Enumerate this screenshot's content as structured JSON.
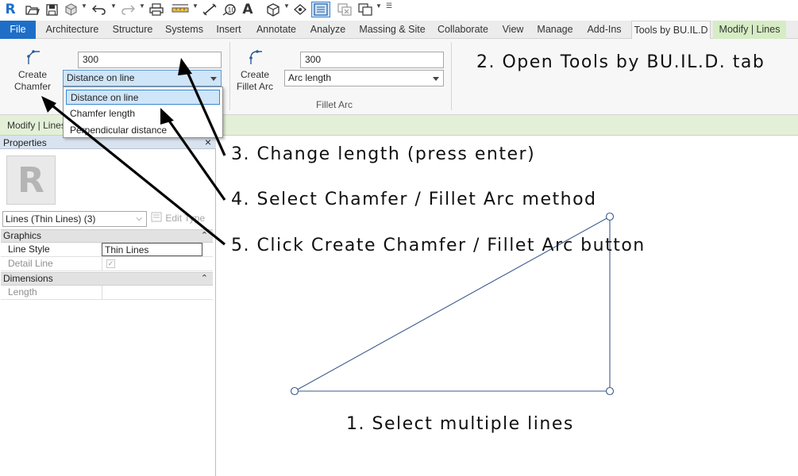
{
  "app": {
    "logo_letter": "R"
  },
  "qat": {
    "icons": [
      "revit-logo-icon",
      "open-icon",
      "save-icon",
      "sync-icon",
      "undo-icon",
      "redo-icon",
      "print-icon",
      "measure-icon",
      "align-dimension-icon",
      "tag-icon",
      "text-icon",
      "3d-view-icon",
      "section-icon",
      "thin-lines-icon",
      "close-hidden-icon",
      "switch-windows-icon",
      "customize-icon"
    ],
    "text_glyph": "A"
  },
  "tabs": [
    {
      "label": "File"
    },
    {
      "label": "Architecture"
    },
    {
      "label": "Structure"
    },
    {
      "label": "Systems"
    },
    {
      "label": "Insert"
    },
    {
      "label": "Annotate"
    },
    {
      "label": "Analyze"
    },
    {
      "label": "Massing & Site"
    },
    {
      "label": "Collaborate"
    },
    {
      "label": "View"
    },
    {
      "label": "Manage"
    },
    {
      "label": "Add-Ins"
    },
    {
      "label": "Tools by BU.IL.D"
    },
    {
      "label": "Modify | Lines"
    }
  ],
  "ribbon": {
    "chamfer": {
      "button_line1": "Create",
      "button_line2": "Chamfer",
      "length_value": "300",
      "method_selected": "Distance on line",
      "method_options": [
        "Distance on line",
        "Chamfer length",
        "Perpendicular distance"
      ]
    },
    "fillet": {
      "button_line1": "Create",
      "button_line2": "Fillet Arc",
      "length_value": "300",
      "method_selected": "Arc length",
      "panel_label": "Fillet Arc"
    }
  },
  "modify_bar": {
    "label": "Modify | Lines"
  },
  "properties": {
    "title": "Properties",
    "close": "×",
    "type_selector": "Lines (Thin Lines) (3)",
    "edit_type": "Edit Type",
    "sections": [
      {
        "label": "Graphics",
        "rows": [
          {
            "name": "Line Style",
            "value": "Thin Lines"
          },
          {
            "name": "Detail Line",
            "value": "✓"
          }
        ]
      },
      {
        "label": "Dimensions",
        "rows": [
          {
            "name": "Length",
            "value": ""
          }
        ]
      }
    ]
  },
  "annotations": {
    "step1": "1. Select multiple lines",
    "step2": "2. Open Tools by BU.IL.D. tab",
    "step3": "3. Change length (press enter)",
    "step4": "4. Select Chamfer / Fillet Arc method",
    "step5": "5. Click Create Chamfer / Fillet Arc button"
  },
  "colors": {
    "file_tab": "#1e6ec8",
    "context_tab": "#d6ecc4",
    "modify_bar": "#e3f0d7",
    "line_color": "#3c5a8c",
    "selection_highlight": "#cfe5f8"
  }
}
